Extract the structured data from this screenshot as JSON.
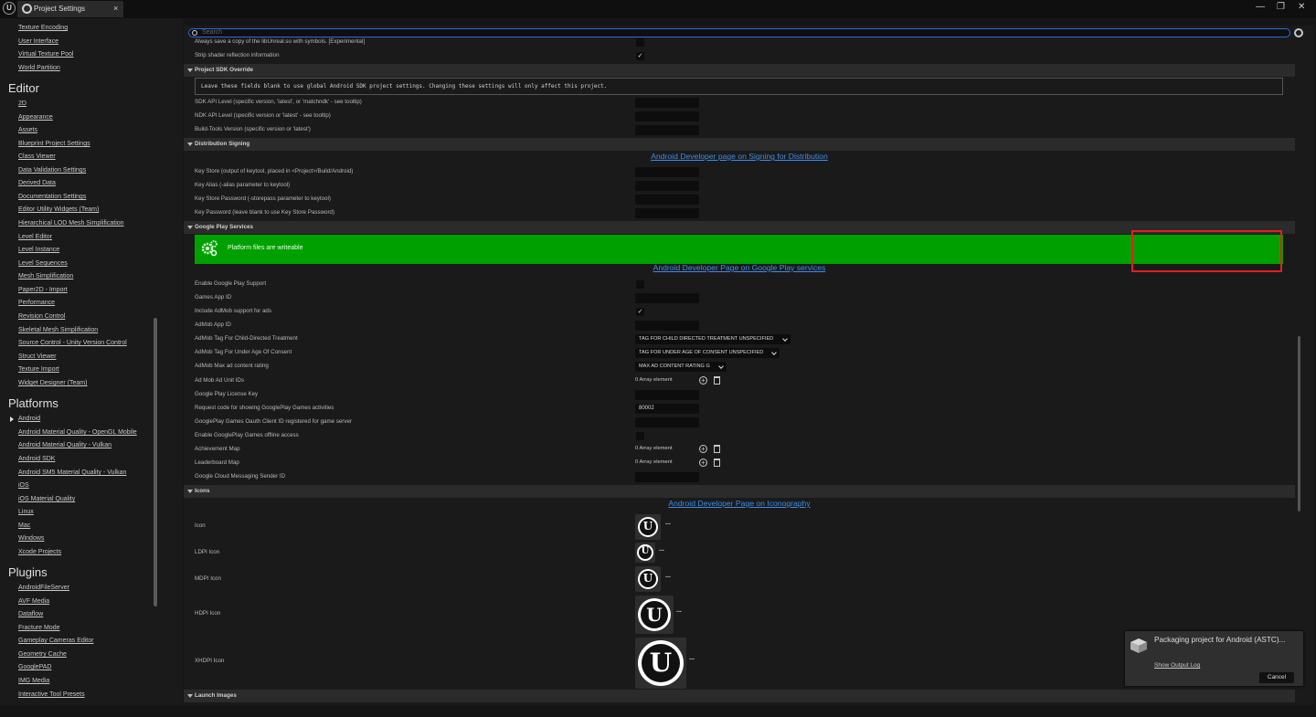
{
  "titlebar": {
    "tab_title": "Project Settings",
    "tab_close": "×",
    "minimize": "—",
    "restore": "❐",
    "close": "✕",
    "logo": "U"
  },
  "search": {
    "placeholder": "Search"
  },
  "sidebar": {
    "top_items": [
      "Texture Encoding",
      "User Interface",
      "Virtual Texture Pool",
      "World Partition"
    ],
    "editor_header": "Editor",
    "editor_items": [
      "2D",
      "Appearance",
      "Assets",
      "Blueprint Project Settings",
      "Class Viewer",
      "Data Validation Settings",
      "Derived Data",
      "Documentation Settings",
      "Editor Utility Widgets (Team)",
      "Hierarchical LOD Mesh Simplification",
      "Level Editor",
      "Level Instance",
      "Level Sequences",
      "Mesh Simplification",
      "Paper2D - Import",
      "Performance",
      "Revision Control",
      "Skeletal Mesh Simplification",
      "Source Control - Unity Version Control",
      "Struct Viewer",
      "Texture Import",
      "Widget Designer (Team)"
    ],
    "platforms_header": "Platforms",
    "platform_items": [
      "Android",
      "Android Material Quality - OpenGL Mobile",
      "Android Material Quality - Vulkan",
      "Android SDK",
      "Android SM5 Material Quality - Vulkan",
      "iOS",
      "iOS Material Quality",
      "Linux",
      "Mac",
      "Windows",
      "Xcode Projects"
    ],
    "plugins_header": "Plugins",
    "plugin_items": [
      "AndroidFileServer",
      "AVF Media",
      "Dataflow",
      "Fracture Mode",
      "Gameplay Cameras Editor",
      "Geometry Cache",
      "GooglePAD",
      "IMG Media",
      "Interactive Tool Presets"
    ]
  },
  "main": {
    "partial_row": "Always save a copy of the libUnreal.so with symbols. [Experimental]",
    "strip_shader": "Strip shader reflection information",
    "sdk_override_header": "Project SDK Override",
    "sdk_note": "Leave these fields blank to use global Android SDK project settings. Changing these settings will only affect this project.",
    "sdk_api": "SDK API Level (specific version, 'latest', or 'matchndk' - see tooltip)",
    "ndk_api": "NDK API Level (specific version or 'latest' - see tooltip)",
    "build_tools": "Build-Tools Version (specific version or 'latest')",
    "dist_signing_header": "Distribution Signing",
    "signing_link": "Android Developer page on Signing for Distribution",
    "key_store": "Key Store (output of keytool, placed in <Project>/Build/Android)",
    "key_alias": "Key Alias (-alias parameter to keytool)",
    "key_store_pw": "Key Store Password (-storepass parameter to keytool)",
    "key_pw": "Key Password (leave blank to use Key Store Password)",
    "gps_header": "Google Play Services",
    "writeable": "Platform files are writeable",
    "gps_link": "Android Developer Page on Google Play services",
    "enable_gps": "Enable Google Play Support",
    "games_app_id": "Games App ID",
    "include_admob": "Include AdMob support for ads",
    "admob_app_id": "AdMob App ID",
    "admob_child": "AdMob Tag For Child-Directed Treatment",
    "admob_child_val": "TAG FOR CHILD DIRECTED TREATMENT UNSPECIFIED",
    "admob_underage": "AdMob Tag For Under Age Of Consent",
    "admob_underage_val": "TAG FOR UNDER AGE OF CONSENT UNSPECIFIED",
    "admob_rating": "AdMob Max ad content rating",
    "admob_rating_val": "MAX AD CONTENT RATING G",
    "ad_unit_ids": "Ad Mob Ad Unit IDs",
    "array_element": "0 Array element",
    "license_key": "Google Play License Key",
    "request_code": "Request code for showing GooglePlay Games activities",
    "request_code_val": "80002",
    "oauth": "GooglePlay Games Oauth Client ID registered for game server",
    "offline": "Enable GooglePlay Games offline access",
    "achievement": "Achievement Map",
    "leaderboard": "Leaderboard Map",
    "gcm_sender": "Google Cloud Messaging Sender ID",
    "icons_header": "Icons",
    "icons_link": "Android Developer Page on Iconography",
    "icon": "Icon",
    "ldpi": "LDPI Icon",
    "mdpi": "MDPI Icon",
    "hdpi": "HDPI Icon",
    "xhdpi": "XHDPI Icon",
    "ellipsis": "...",
    "ue_glyph": "U",
    "launch_header": "Launch Images"
  },
  "toast": {
    "message": "Packaging project for Android (ASTC)...",
    "show_log": "Show Output Log",
    "cancel": "Cancel"
  },
  "colors": {
    "accent_blue": "#2a6bd8",
    "link_blue": "#3f8ce8",
    "writeable_green": "#00a000",
    "highlight_red": "#e02020"
  }
}
